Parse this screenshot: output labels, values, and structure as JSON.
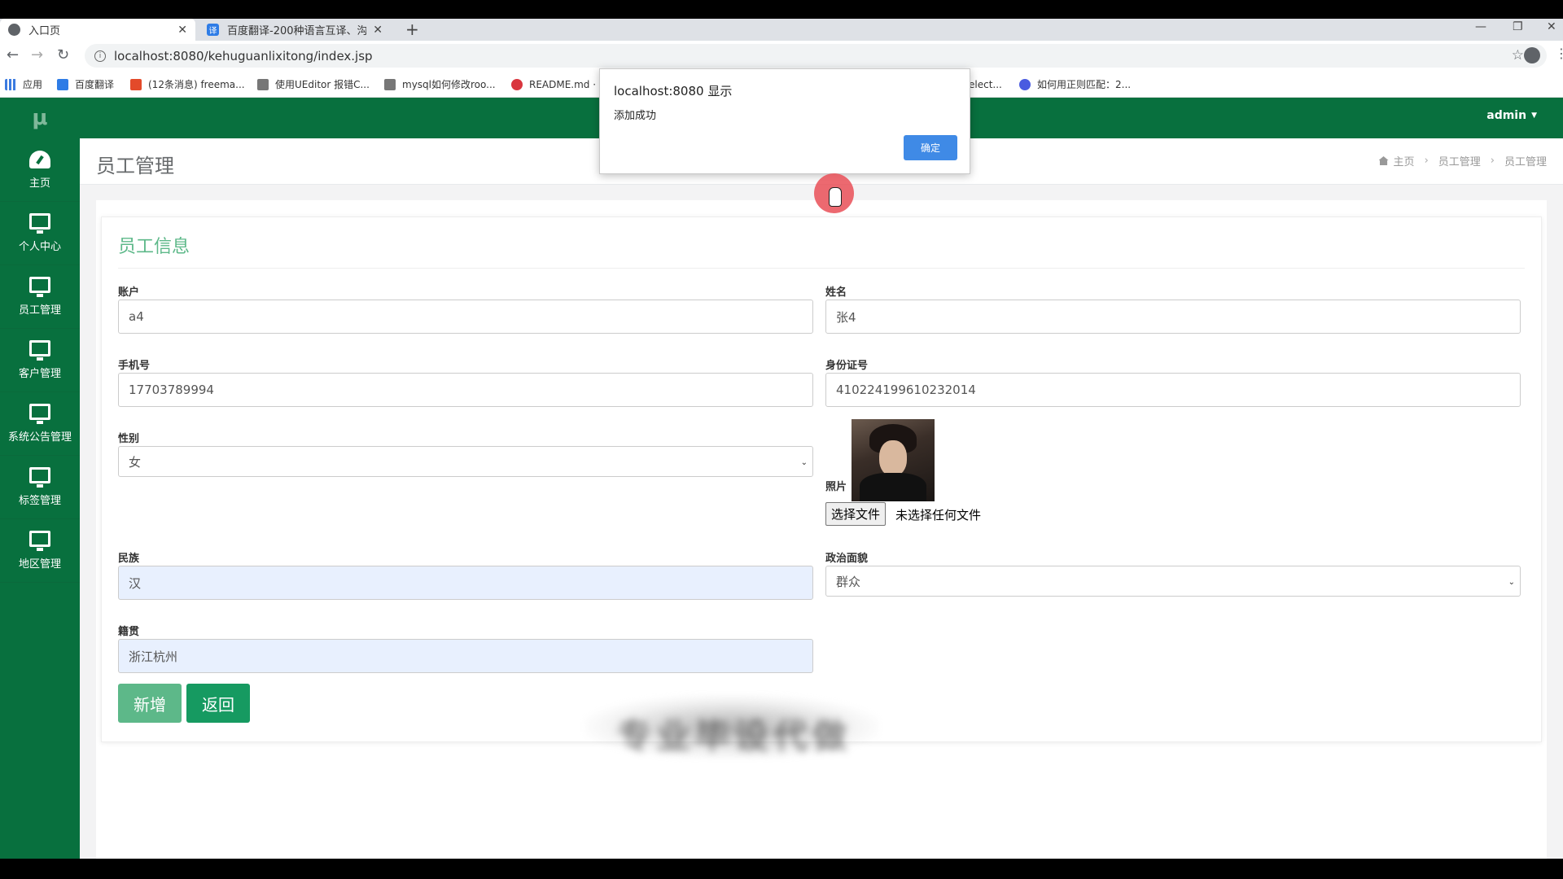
{
  "browser": {
    "tabs": [
      {
        "title": "入口页",
        "close": "✕"
      },
      {
        "title": "百度翻译-200种语言互译、沟通",
        "close": "✕",
        "icon": "译"
      }
    ],
    "new_tab": "+",
    "window_controls": [
      "—",
      "❐",
      "✕"
    ],
    "url": "localhost:8080/kehuguanlixitong/index.jsp",
    "nav": {
      "back": "←",
      "forward": "→",
      "reload": "↻",
      "star": "☆",
      "menu": "⋮"
    },
    "bookmarks": [
      {
        "label": "应用",
        "color": "#3c7be0"
      },
      {
        "label": "百度翻译",
        "color": "#2e7ce6"
      },
      {
        "label": "(12条消息) freema...",
        "color": "#e34a2a"
      },
      {
        "label": "使用UEditor 报错C...",
        "color": "#444444"
      },
      {
        "label": "mysql如何修改roo...",
        "color": "#444444"
      },
      {
        "label": "README.md ·",
        "color": "#d9363e"
      },
      {
        "label": "elect...",
        "color": "#ffffff"
      },
      {
        "label": "如何用正则匹配：2...",
        "color": "#4a5be0"
      }
    ]
  },
  "sidebar": {
    "brand": "μ",
    "items": [
      {
        "label": "主页",
        "icon": "dashboard-icon"
      },
      {
        "label": "个人中心",
        "icon": "monitor-icon"
      },
      {
        "label": "员工管理",
        "icon": "monitor-icon"
      },
      {
        "label": "客户管理",
        "icon": "monitor-icon"
      },
      {
        "label": "系统公告管理",
        "icon": "monitor-icon"
      },
      {
        "label": "标签管理",
        "icon": "monitor-icon"
      },
      {
        "label": "地区管理",
        "icon": "monitor-icon"
      }
    ]
  },
  "topnav": {
    "user": "admin",
    "caret": "▼"
  },
  "page": {
    "title": "员工管理",
    "breadcrumb": [
      "主页",
      "员工管理",
      "员工管理"
    ],
    "breadcrumb_sep": "›"
  },
  "form": {
    "title": "员工信息",
    "account_label": "账户",
    "account_value": "a4",
    "name_label": "姓名",
    "name_value": "张4",
    "phone_label": "手机号",
    "phone_value": "17703789994",
    "idcard_label": "身份证号",
    "idcard_value": "410224199610232014",
    "gender_label": "性别",
    "gender_value": "女",
    "photo_label": "照片",
    "file_button": "选择文件",
    "file_status": "未选择任何文件",
    "ethnicity_label": "民族",
    "ethnicity_value": "汉",
    "political_label": "政治面貌",
    "political_value": "群众",
    "hometown_label": "籍贯",
    "hometown_value": "浙江杭州",
    "add_button": "新增",
    "back_button": "返回",
    "select_arrow": "⌄"
  },
  "dialog": {
    "title": "localhost:8080 显示",
    "message": "添加成功",
    "ok_button": "确定"
  },
  "blurred_text": "专业毕设代做"
}
